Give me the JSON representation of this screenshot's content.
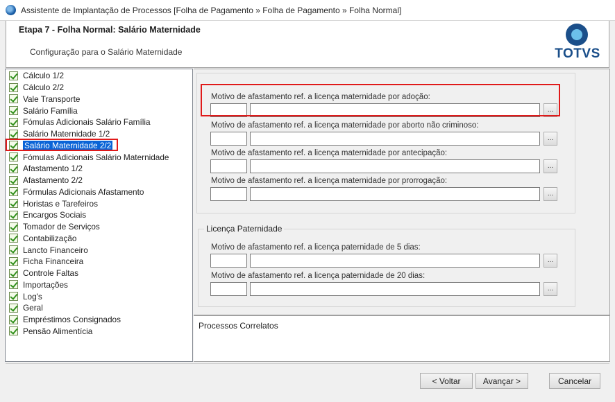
{
  "window": {
    "title": "Assistente de Implantação de Processos [Folha de Pagamento » Folha de Pagamento » Folha Normal]"
  },
  "header": {
    "step_title": "Etapa 7 - Folha Normal: Salário Maternidade",
    "subtitle": "Configuração para o Salário Maternidade",
    "logo_text": "TOTVS"
  },
  "tree": {
    "items": [
      {
        "label": "Cálculo 1/2"
      },
      {
        "label": "Cálculo 2/2"
      },
      {
        "label": "Vale Transporte"
      },
      {
        "label": "Salário Família"
      },
      {
        "label": "Fómulas Adicionais Salário Família"
      },
      {
        "label": "Salário Maternidade 1/2"
      },
      {
        "label": "Salário Maternidade 2/2",
        "selected": true
      },
      {
        "label": "Fómulas Adicionais Salário Maternidade"
      },
      {
        "label": "Afastamento 1/2"
      },
      {
        "label": "Afastamento 2/2"
      },
      {
        "label": "Fórmulas Adicionais Afastamento"
      },
      {
        "label": "Horistas e Tarefeiros"
      },
      {
        "label": "Encargos Sociais"
      },
      {
        "label": "Tomador de Serviços"
      },
      {
        "label": "Contabilização"
      },
      {
        "label": "Lancto Financeiro"
      },
      {
        "label": "Ficha Financeira"
      },
      {
        "label": "Controle Faltas"
      },
      {
        "label": "Importações"
      },
      {
        "label": "Log's"
      },
      {
        "label": "Geral"
      },
      {
        "label": "Empréstimos Consignados"
      },
      {
        "label": "Pensão Alimentícia"
      }
    ]
  },
  "maternidade_fields": [
    {
      "label": "Motivo de afastamento ref. a licença maternidade por adoção:",
      "code": "",
      "description": ""
    },
    {
      "label": "Motivo de afastamento ref. a licença maternidade por aborto não criminoso:",
      "code": "",
      "description": ""
    },
    {
      "label": "Motivo de afastamento ref. a licença maternidade por antecipação:",
      "code": "",
      "description": ""
    },
    {
      "label": "Motivo de afastamento ref. a licença maternidade por prorrogação:",
      "code": "",
      "description": ""
    }
  ],
  "paternidade": {
    "group_title": "Licença Paternidade",
    "fields": [
      {
        "label": "Motivo de afastamento ref. a licença  paternidade  de 5 dias:",
        "code": "",
        "description": ""
      },
      {
        "label": "Motivo de afastamento ref. a licença  paternidade  de 20 dias:",
        "code": "",
        "description": ""
      }
    ]
  },
  "lookup_label": "...",
  "processos": {
    "title": "Processos Correlatos"
  },
  "buttons": {
    "back": "< Voltar",
    "next": "Avançar >",
    "cancel": "Cancelar"
  },
  "colors": {
    "selection": "#0a64d7",
    "highlight": "#e01a1a",
    "brand": "#1b4f8a"
  }
}
